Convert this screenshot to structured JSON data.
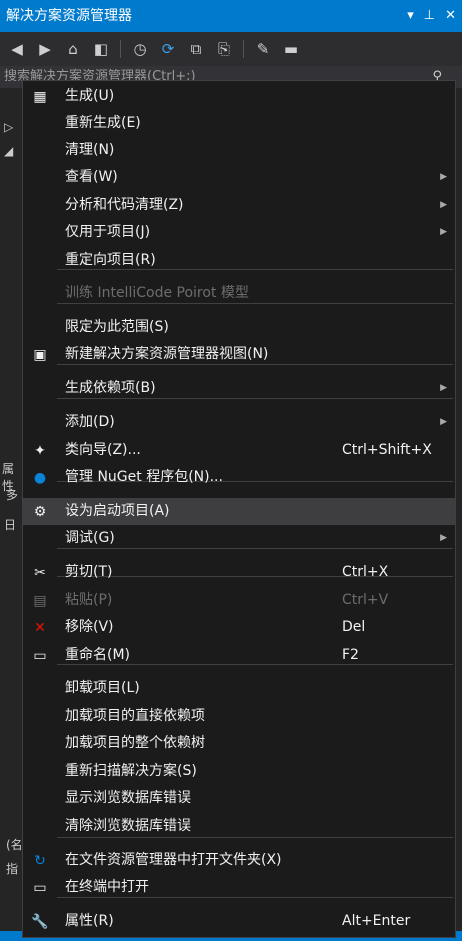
{
  "window": {
    "title": "解决方案资源管理器",
    "title_icons": [
      "▾",
      "⊥",
      "✕"
    ]
  },
  "search": {
    "placeholder": "搜索解决方案资源管理器(Ctrl+;)"
  },
  "left_pane": {
    "items": [
      "▷",
      "◢",
      "属性",
      "多",
      "日",
      "(名",
      "指"
    ]
  },
  "context_menu": {
    "items": [
      {
        "label": "生成(U)",
        "icon": "build-icon",
        "glyph": "▦"
      },
      {
        "label": "重新生成(E)"
      },
      {
        "label": "清理(N)"
      },
      {
        "label": "查看(W)",
        "submenu": true
      },
      {
        "label": "分析和代码清理(Z)",
        "submenu": true
      },
      {
        "label": "仅用于项目(J)",
        "submenu": true
      },
      {
        "label": "重定向项目(R)"
      },
      {
        "label": "训练 IntelliCode Poirot 模型",
        "disabled": true
      },
      {
        "label": "限定为此范围(S)"
      },
      {
        "label": "新建解决方案资源管理器视图(N)",
        "icon": "new-view-icon",
        "glyph": "▣"
      },
      {
        "label": "生成依赖项(B)",
        "submenu": true
      },
      {
        "label": "添加(D)",
        "submenu": true
      },
      {
        "label": "类向导(Z)...",
        "shortcut": "Ctrl+Shift+X",
        "icon": "class-wizard-icon",
        "glyph": "✦"
      },
      {
        "label": "管理 NuGet 程序包(N)...",
        "icon": "nuget-icon",
        "glyph": "●"
      },
      {
        "label": "设为启动项目(A)",
        "icon": "gear-icon",
        "glyph": "⚙"
      },
      {
        "label": "调试(G)",
        "submenu": true
      },
      {
        "label": "剪切(T)",
        "shortcut": "Ctrl+X",
        "icon": "scissors-icon",
        "glyph": "✂"
      },
      {
        "label": "粘贴(P)",
        "shortcut": "Ctrl+V",
        "disabled": true,
        "icon": "paste-icon",
        "glyph": "▤"
      },
      {
        "label": "移除(V)",
        "shortcut": "Del",
        "icon": "remove-icon",
        "glyph": "✕"
      },
      {
        "label": "重命名(M)",
        "shortcut": "F2",
        "icon": "rename-icon",
        "glyph": "▭"
      },
      {
        "label": "卸载项目(L)"
      },
      {
        "label": "加载项目的直接依赖项"
      },
      {
        "label": "加载项目的整个依赖树"
      },
      {
        "label": "重新扫描解决方案(S)"
      },
      {
        "label": "显示浏览数据库错误"
      },
      {
        "label": "清除浏览数据库错误"
      },
      {
        "label": "在文件资源管理器中打开文件夹(X)",
        "icon": "open-folder-icon",
        "glyph": "↻"
      },
      {
        "label": "在终端中打开",
        "icon": "terminal-icon",
        "glyph": "▭"
      },
      {
        "label": "属性(R)",
        "shortcut": "Alt+Enter",
        "icon": "wrench-icon",
        "glyph": "🔧"
      }
    ],
    "highlighted_index": 14
  },
  "colors": {
    "accent": "#007acc",
    "menu_bg": "#1b1b1c",
    "remove_icon": "#e51400",
    "nuget_icon": "#0a84d6"
  }
}
